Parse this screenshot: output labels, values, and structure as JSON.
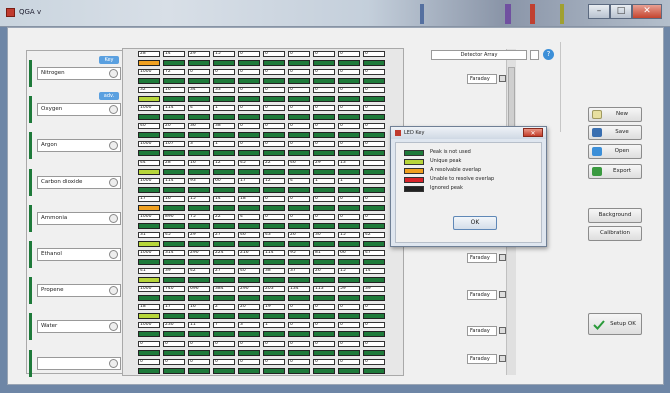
{
  "window": {
    "title": "QGA v",
    "minimize": "–",
    "maximize": "□",
    "close": "✕"
  },
  "gases": [
    {
      "name": "Nitrogen",
      "key_label": "Key",
      "show_key": true
    },
    {
      "name": "Oxygen",
      "key_label": "adv.",
      "show_key": true
    },
    {
      "name": "Argon",
      "key_label": "",
      "show_key": false
    },
    {
      "name": "Carbon dioxide",
      "key_label": "",
      "show_key": false
    },
    {
      "name": "Ammonia",
      "key_label": "",
      "show_key": false
    },
    {
      "name": "Ethanol",
      "key_label": "",
      "show_key": false
    },
    {
      "name": "Propene",
      "key_label": "",
      "show_key": false
    },
    {
      "name": "Water",
      "key_label": "",
      "show_key": false
    },
    {
      "name": "",
      "key_label": "",
      "show_key": false
    }
  ],
  "grid": [
    {
      "masses": [
        "28",
        "14",
        "29",
        "15",
        "0",
        "0",
        "0",
        "0",
        "0",
        "0"
      ],
      "intensities": [
        "1000",
        "72",
        "0",
        "0",
        "0",
        "0",
        "0",
        "0",
        "0",
        "0"
      ],
      "leds": [
        "yellow",
        "green",
        "green",
        "green",
        "green",
        "green",
        "green",
        "green",
        "green",
        "green"
      ]
    },
    {
      "masses": [
        "32",
        "16",
        "34",
        "33",
        "0",
        "0",
        "0",
        "0",
        "0",
        "0"
      ],
      "intensities": [
        "1000",
        "114",
        "4",
        "1",
        "0",
        "0",
        "0",
        "0",
        "0",
        "0"
      ],
      "leds": [
        "yellowgreen",
        "green",
        "green",
        "green",
        "green",
        "green",
        "green",
        "green",
        "green",
        "green"
      ]
    },
    {
      "masses": [
        "40",
        "20",
        "36",
        "38",
        "0",
        "0",
        "0",
        "0",
        "0",
        "0"
      ],
      "intensities": [
        "1000",
        "107",
        "3",
        "1",
        "0",
        "0",
        "0",
        "0",
        "0",
        "0"
      ],
      "leds": [
        "green",
        "green",
        "green",
        "green",
        "green",
        "green",
        "green",
        "green",
        "green",
        "green"
      ]
    },
    {
      "masses": [
        "44",
        "28",
        "16",
        "12",
        "45",
        "22",
        "46",
        "29",
        "13",
        ""
      ],
      "intensities": [
        "1000",
        "114",
        "93",
        "60",
        "17",
        "12",
        "4",
        "1",
        "1",
        ""
      ],
      "leds": [
        "yellowgreen",
        "green",
        "green",
        "green",
        "green",
        "green",
        "green",
        "green",
        "green",
        "green"
      ]
    },
    {
      "masses": [
        "17",
        "16",
        "15",
        "14",
        "18",
        "0",
        "0",
        "0",
        "0",
        "0"
      ],
      "intensities": [
        "1000",
        "890",
        "75",
        "22",
        "4",
        "0",
        "0",
        "0",
        "0",
        "0"
      ],
      "leds": [
        "orange",
        "green",
        "green",
        "green",
        "green",
        "green",
        "green",
        "green",
        "green",
        "green"
      ]
    },
    {
      "masses": [
        "31",
        "45",
        "29",
        "27",
        "46",
        "43",
        "26",
        "30",
        "15",
        "42"
      ],
      "intensities": [
        "1000",
        "314",
        "290",
        "224",
        "216",
        "114",
        "95",
        "81",
        "66",
        "47"
      ],
      "leds": [
        "yellowgreen",
        "green",
        "green",
        "green",
        "green",
        "green",
        "green",
        "green",
        "green",
        "green"
      ]
    },
    {
      "masses": [
        "41",
        "39",
        "42",
        "27",
        "40",
        "38",
        "37",
        "26",
        "15",
        "14"
      ],
      "intensities": [
        "1000",
        "740",
        "696",
        "384",
        "290",
        "203",
        "134",
        "113",
        "59",
        "39"
      ],
      "leds": [
        "yellowgreen",
        "green",
        "green",
        "green",
        "green",
        "green",
        "green",
        "green",
        "green",
        "green"
      ]
    },
    {
      "masses": [
        "18",
        "17",
        "16",
        "2",
        "20",
        "19",
        "0",
        "0",
        "0",
        "0"
      ],
      "intensities": [
        "1000",
        "230",
        "11",
        "7",
        "3",
        "1",
        "0",
        "0",
        "0",
        "0"
      ],
      "leds": [
        "yellowgreen",
        "green",
        "green",
        "green",
        "green",
        "green",
        "green",
        "green",
        "green",
        "green"
      ]
    },
    {
      "masses": [
        "0",
        "0",
        "0",
        "0",
        "0",
        "0",
        "0",
        "0",
        "0",
        "0"
      ],
      "intensities": [
        "0",
        "0",
        "0",
        "0",
        "0",
        "0",
        "0",
        "0",
        "0",
        "0"
      ],
      "leds": [
        "green",
        "green",
        "green",
        "green",
        "green",
        "green",
        "green",
        "green",
        "green",
        "green"
      ]
    }
  ],
  "detector": {
    "label": "Detector Array"
  },
  "faraday_label": "Faraday",
  "actions": {
    "new": "New",
    "save": "Save",
    "open": "Open",
    "export": "Export",
    "background": "Background",
    "calibration": "Calibration",
    "setup_ok": "Setup OK"
  },
  "led_dialog": {
    "title": "LED Key",
    "items": [
      {
        "label": "Peak is not used",
        "color": "#1e7a3a"
      },
      {
        "label": "Unique peak",
        "color": "#b7d63a"
      },
      {
        "label": "A resolvable overlap",
        "color": "#f0a020"
      },
      {
        "label": "Unable to resolve overlap",
        "color": "#d8242a"
      },
      {
        "label": "Ignored peak",
        "color": "#222222"
      }
    ],
    "ok": "OK"
  },
  "colors": {
    "green": "#1e7a3a",
    "yellow": "#f0a020",
    "yellowgreen": "#b7d63a",
    "orange": "#f0a020"
  }
}
